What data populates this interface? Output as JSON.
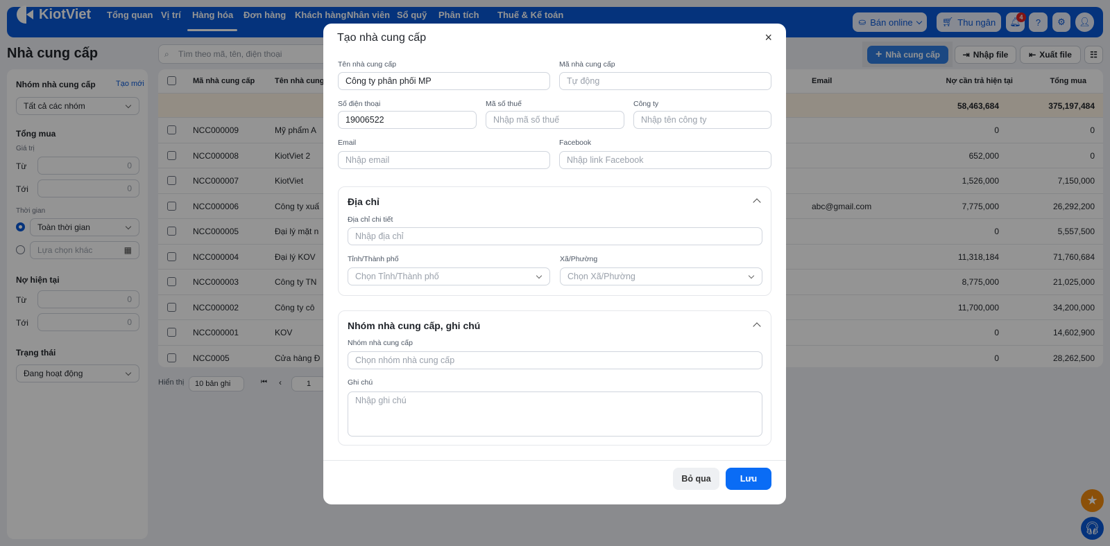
{
  "nav": {
    "brand": "KiotViet",
    "items": [
      "Tổng quan",
      "Vị trí",
      "Hàng hóa",
      "Đơn hàng",
      "Khách hàng",
      "Nhân viên",
      "Sổ quỹ",
      "Phân tích",
      "Thuế & Kế toán"
    ],
    "active": "Hàng hóa",
    "online_label": "Bán online",
    "cashier_label": "Thu ngân",
    "notification_count": "4"
  },
  "page": {
    "title": "Nhà cung cấp",
    "search_placeholder": "Tìm theo mã, tên, điện thoại",
    "add_label": "Nhà cung cấp",
    "import_label": "Nhập file",
    "export_label": "Xuất file"
  },
  "filters": {
    "group_title": "Nhóm nhà cung cấp",
    "create_new": "Tạo mới",
    "group_value": "Tất cả các nhóm",
    "total_title": "Tổng mua",
    "value_label": "Giá trị",
    "from": "Từ",
    "to": "Tới",
    "zero": "0",
    "time_label": "Thời gian",
    "time_all": "Toàn thời gian",
    "time_other": "Lựa chọn khác",
    "debt_title": "Nợ hiện tại",
    "status_title": "Trạng thái",
    "status_value": "Đang hoạt động"
  },
  "table": {
    "headers": {
      "code": "Mã nhà cung cấp",
      "name": "Tên nhà cung",
      "email": "Email",
      "debt": "Nợ cần trả hiện tại",
      "total": "Tổng mua"
    },
    "summary": {
      "debt": "58,463,684",
      "total": "375,197,484"
    },
    "rows": [
      {
        "code": "NCC000009",
        "name": "Mỹ phẩm A",
        "email": "",
        "debt": "0",
        "total": "0"
      },
      {
        "code": "NCC000008",
        "name": "KiotViet 2",
        "email": "",
        "debt": "652,000",
        "total": "0"
      },
      {
        "code": "NCC000007",
        "name": "KiotViet",
        "email": "",
        "debt": "1,526,000",
        "total": "7,150,000"
      },
      {
        "code": "NCC000006",
        "name": "Công ty xuấ",
        "email": "abc@gmail.com",
        "debt": "7,775,000",
        "total": "26,292,200"
      },
      {
        "code": "NCC000005",
        "name": "Đại lý mặt n",
        "email": "",
        "debt": "0",
        "total": "5,557,500"
      },
      {
        "code": "NCC000004",
        "name": "Đại lý KOV",
        "email": "",
        "debt": "11,318,184",
        "total": "71,760,684"
      },
      {
        "code": "NCC000003",
        "name": "Công ty TN",
        "email": "",
        "debt": "8,775,000",
        "total": "21,025,000"
      },
      {
        "code": "NCC000002",
        "name": "Công ty cô",
        "email": "",
        "debt": "11,700,000",
        "total": "34,200,000"
      },
      {
        "code": "NCC000001",
        "name": "KOV",
        "email": "",
        "debt": "0",
        "total": "14,602,900"
      },
      {
        "code": "NCC0005",
        "name": "Cửa hàng Đ",
        "email": "",
        "debt": "0",
        "total": "28,262,500"
      }
    ],
    "pagination": {
      "show_label": "Hiển thị",
      "page_size": "10 bản ghi",
      "page": "1"
    }
  },
  "modal": {
    "title": "Tạo nhà cung cấp",
    "name_label": "Tên nhà cung cấp",
    "name_value": "Công ty phân phối MP",
    "code_label": "Mã nhà cung cấp",
    "code_placeholder": "Tự động",
    "phone_label": "Số điện thoại",
    "phone_value": "19006522",
    "tax_label": "Mã số thuế",
    "tax_placeholder": "Nhập mã số thuế",
    "company_label": "Công ty",
    "company_placeholder": "Nhập tên công ty",
    "email_label": "Email",
    "email_placeholder": "Nhập email",
    "facebook_label": "Facebook",
    "facebook_placeholder": "Nhập link Facebook",
    "address": {
      "title": "Địa chỉ",
      "detail_label": "Địa chỉ chi tiết",
      "detail_placeholder": "Nhập địa chỉ",
      "city_label": "Tỉnh/Thành phố",
      "city_placeholder": "Chọn Tỉnh/Thành phố",
      "ward_label": "Xã/Phường",
      "ward_placeholder": "Chọn Xã/Phường"
    },
    "group": {
      "title": "Nhóm nhà cung cấp, ghi chú",
      "group_label": "Nhóm nhà cung cấp",
      "group_placeholder": "Chọn nhóm nhà cung cấp",
      "note_label": "Ghi chú",
      "note_placeholder": "Nhập ghi chú"
    },
    "cancel_label": "Bỏ qua",
    "save_label": "Lưu"
  },
  "colors": {
    "brand": "#0a58d6",
    "save": "#0a6cf5",
    "star_fab": "#f08a10"
  }
}
